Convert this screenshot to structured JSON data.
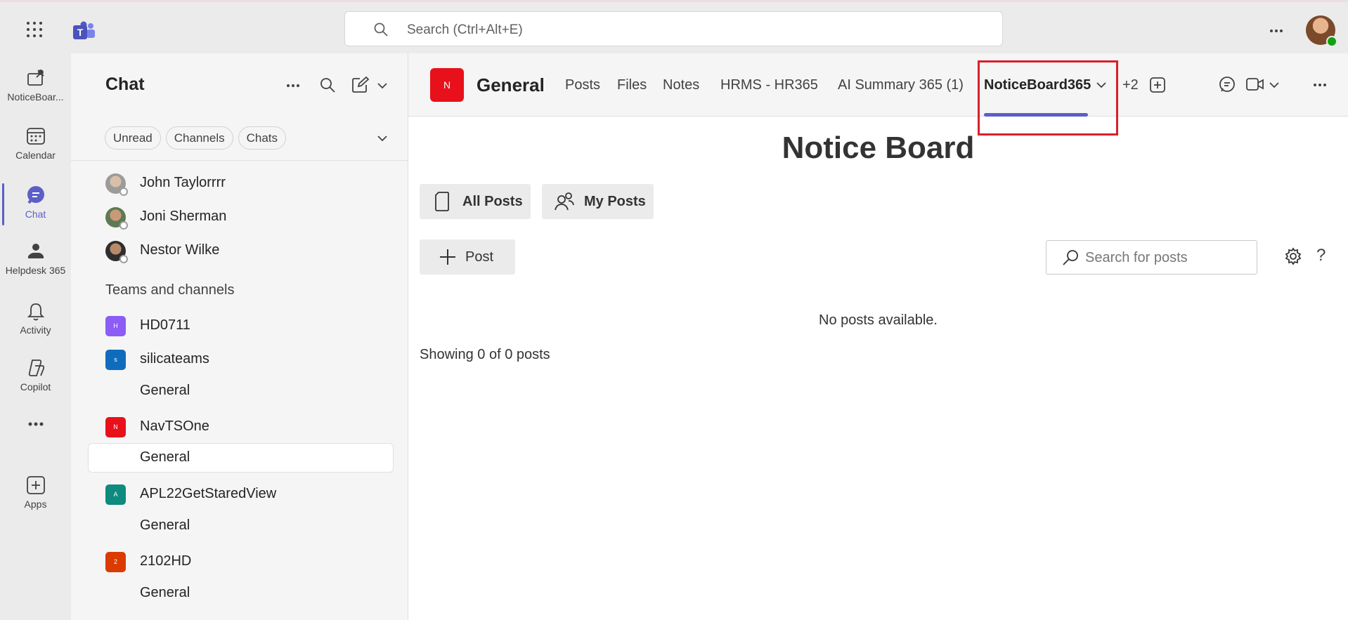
{
  "topbar": {
    "search_placeholder": "Search (Ctrl+Alt+E)"
  },
  "rail": {
    "items": [
      {
        "label": "NoticeBoar...",
        "icon": "noticeboard-icon"
      },
      {
        "label": "Calendar",
        "icon": "calendar-icon"
      },
      {
        "label": "Chat",
        "icon": "chat-icon",
        "active": true
      },
      {
        "label": "Helpdesk 365",
        "icon": "helpdesk-icon"
      },
      {
        "label": "Activity",
        "icon": "bell-icon"
      },
      {
        "label": "Copilot",
        "icon": "copilot-icon"
      },
      {
        "label": "",
        "icon": "more-icon"
      },
      {
        "label": "Apps",
        "icon": "apps-icon"
      }
    ]
  },
  "panel": {
    "title": "Chat",
    "filters": [
      "Unread",
      "Channels",
      "Chats"
    ],
    "chats": [
      {
        "name": "John Taylorrrr"
      },
      {
        "name": "Joni Sherman"
      },
      {
        "name": "Nestor Wilke"
      }
    ],
    "section_label": "Teams and channels",
    "teams": [
      {
        "initial": "H",
        "name": "HD0711",
        "color": "#8b5cf6"
      },
      {
        "initial": "s",
        "name": "silicateams",
        "color": "#0f6cbd"
      },
      {
        "channel": "General"
      },
      {
        "initial": "N",
        "name": "NavTSOne",
        "color": "#e8101a"
      },
      {
        "channel": "General",
        "selected": true
      },
      {
        "initial": "A",
        "name": "APL22GetStaredView",
        "color": "#0e8a7e"
      },
      {
        "channel": "General"
      },
      {
        "initial": "2",
        "name": "2102HD",
        "color": "#da3b01"
      },
      {
        "channel": "General"
      }
    ]
  },
  "channel": {
    "logo_initial": "N",
    "logo_color": "#e8101a",
    "name": "General",
    "tabs": [
      "Posts",
      "Files",
      "Notes",
      "HRMS - HR365",
      "AI Summary 365 (1)",
      "NoticeBoard365"
    ],
    "active_tab": "NoticeBoard365",
    "overflow": "+2"
  },
  "notice_board": {
    "title": "Notice Board",
    "all_posts_label": "All Posts",
    "my_posts_label": "My Posts",
    "post_button_label": "Post",
    "search_placeholder": "Search for posts",
    "help_label": "?",
    "empty_message": "No posts available.",
    "showing_text": "Showing 0 of 0 posts"
  },
  "colors": {
    "accent": "#5b5fc7",
    "highlight": "#d9202a"
  }
}
